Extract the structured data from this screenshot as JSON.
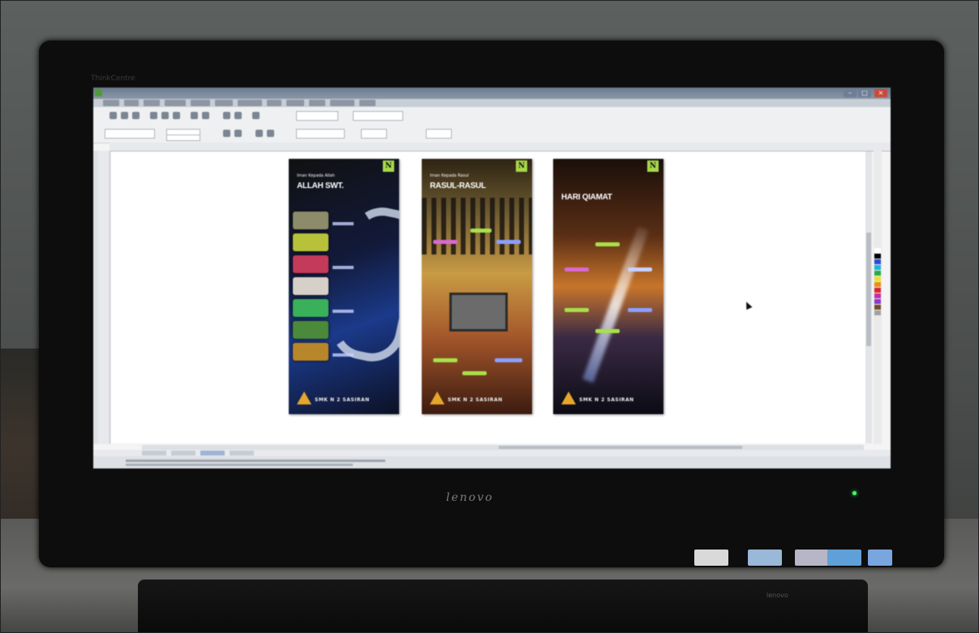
{
  "scene": {
    "monitor_brand": "lenovo",
    "monitor_model_label": "ThinkCentre",
    "keyboard_brand": "lenovo"
  },
  "app": {
    "icon_name": "coreldraw-app-icon",
    "window_controls": [
      "minimize-icon",
      "maximize-icon",
      "close-icon"
    ]
  },
  "posters": [
    {
      "badge": "N",
      "subtitle": "Iman Kepada Allah",
      "title": "ALLAH SWT.",
      "footer": "SMK N 2 SASIRAN",
      "accent": "#1b3a8a"
    },
    {
      "badge": "N",
      "subtitle": "Iman Kepada Rasul",
      "title": "RASUL-RASUL",
      "footer": "SMK N 2 SASIRAN",
      "accent": "#c99b44"
    },
    {
      "badge": "N",
      "subtitle": "",
      "title": "HARI QIAMAT",
      "footer": "SMK N 2 SASIRAN",
      "accent": "#c8752b"
    }
  ],
  "colors": {
    "titlebar": "#7b8a9e",
    "canvas": "#ffffff",
    "badge": "#a7d84a",
    "power_led": "#3cff6a"
  }
}
